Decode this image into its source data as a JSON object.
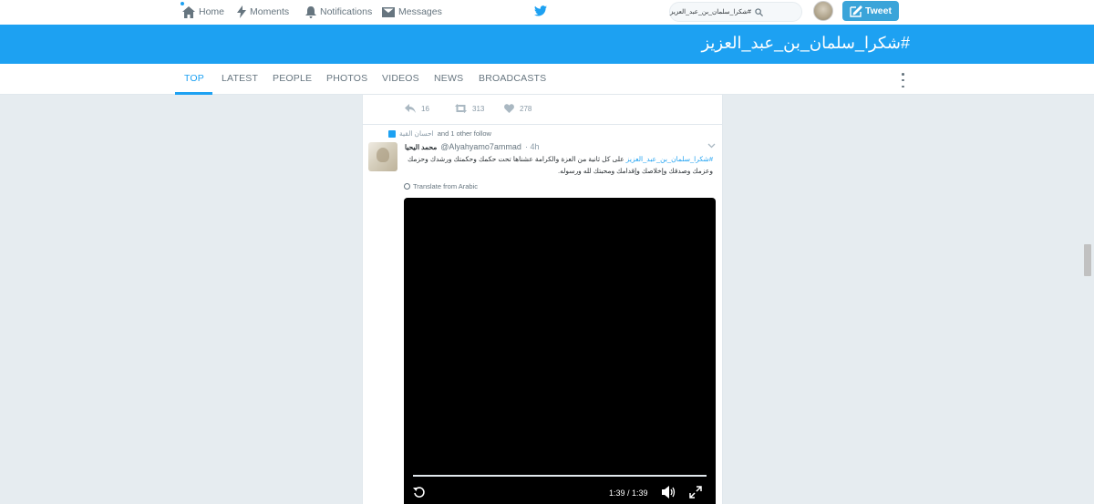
{
  "nav": {
    "home": "Home",
    "moments": "Moments",
    "notifications": "Notifications",
    "messages": "Messages"
  },
  "search": {
    "value": "#شكرا_سلمان_بن_عبد_العزيز"
  },
  "tweet_button": "Tweet",
  "banner_title": "#شكرا_سلمان_بن_عبد_العزيز",
  "tabs": [
    {
      "label": "TOP"
    },
    {
      "label": "LATEST"
    },
    {
      "label": "PEOPLE"
    },
    {
      "label": "PHOTOS"
    },
    {
      "label": "VIDEOS"
    },
    {
      "label": "NEWS"
    },
    {
      "label": "BROADCASTS"
    }
  ],
  "prev_tweet_actions": {
    "replies": "16",
    "retweets": "313",
    "likes": "278"
  },
  "tweet": {
    "context_follow": "and 1 other follow",
    "context_name": "احسان القية",
    "author_name": "محمد اليحيا",
    "handle": "@Alyahyamo7ammad",
    "time": "4h",
    "hashtag": "#شكرا_سلمان_بن_عبد_العزيز",
    "text": " على كل ثانية من العزة والكرامة عشناها تحت حكمك وحكمتك ورشدك وحزمك وعزمك وصدقك وإخلاصك وإقدامك ومحبتك لله ورسوله.",
    "translate": "Translate from Arabic",
    "video_time": "1:39 / 1:39",
    "video_progress_fraction": 1.0
  },
  "icons": {
    "home": "home-icon",
    "moments": "lightning-icon",
    "notifications": "bell-icon",
    "messages": "envelope-icon",
    "logo": "bird-icon",
    "search": "magnifier-icon"
  },
  "colors": {
    "accent": "#1da1f2",
    "tweet_button": "#3aa4d9",
    "background": "#e6ecf0"
  }
}
